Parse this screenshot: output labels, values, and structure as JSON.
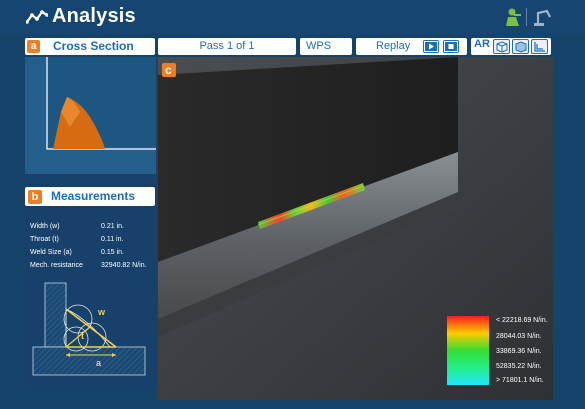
{
  "app": {
    "title": "Analysis",
    "icons": [
      "chart-line-icon",
      "welder-icon",
      "robot-arm-icon"
    ],
    "accent": "#ef7d22",
    "brand_blue": "#154570",
    "header_blue": "#1d6fb0"
  },
  "cross_section": {
    "badge": "a",
    "title": "Cross Section"
  },
  "toolbar": {
    "pass_label": "Pass 1 of 1",
    "wps_label": "WPS",
    "replay_label": "Replay",
    "ar_label": "AR",
    "icons": [
      "play-icon",
      "stop-icon",
      "ar-icon",
      "box-outline-icon",
      "box-solid-icon",
      "layers-icon"
    ]
  },
  "viewport": {
    "badge": "c"
  },
  "measurements": {
    "badge": "b",
    "title": "Measurements",
    "rows": [
      {
        "label": "Width (w)",
        "value": "0.21 in."
      },
      {
        "label": "Throat (t)",
        "value": "0.11 in."
      },
      {
        "label": "Weld Size (a)",
        "value": "0.15 in."
      },
      {
        "label": "Mech. resistance",
        "value": "32940.82 N/in."
      }
    ],
    "diagram_labels": {
      "w": "w",
      "t": "t",
      "a": "a"
    }
  },
  "legend": {
    "labels": [
      "< 22218.69 N/in.",
      "28044.03 N/in.",
      "33869.36 N/in.",
      "52835.22 N/in.",
      "> 71801.1 N/in."
    ],
    "colors": [
      "#ff1a1a",
      "#ffcc00",
      "#33dd33",
      "#22ee88",
      "#22e6ff"
    ]
  }
}
